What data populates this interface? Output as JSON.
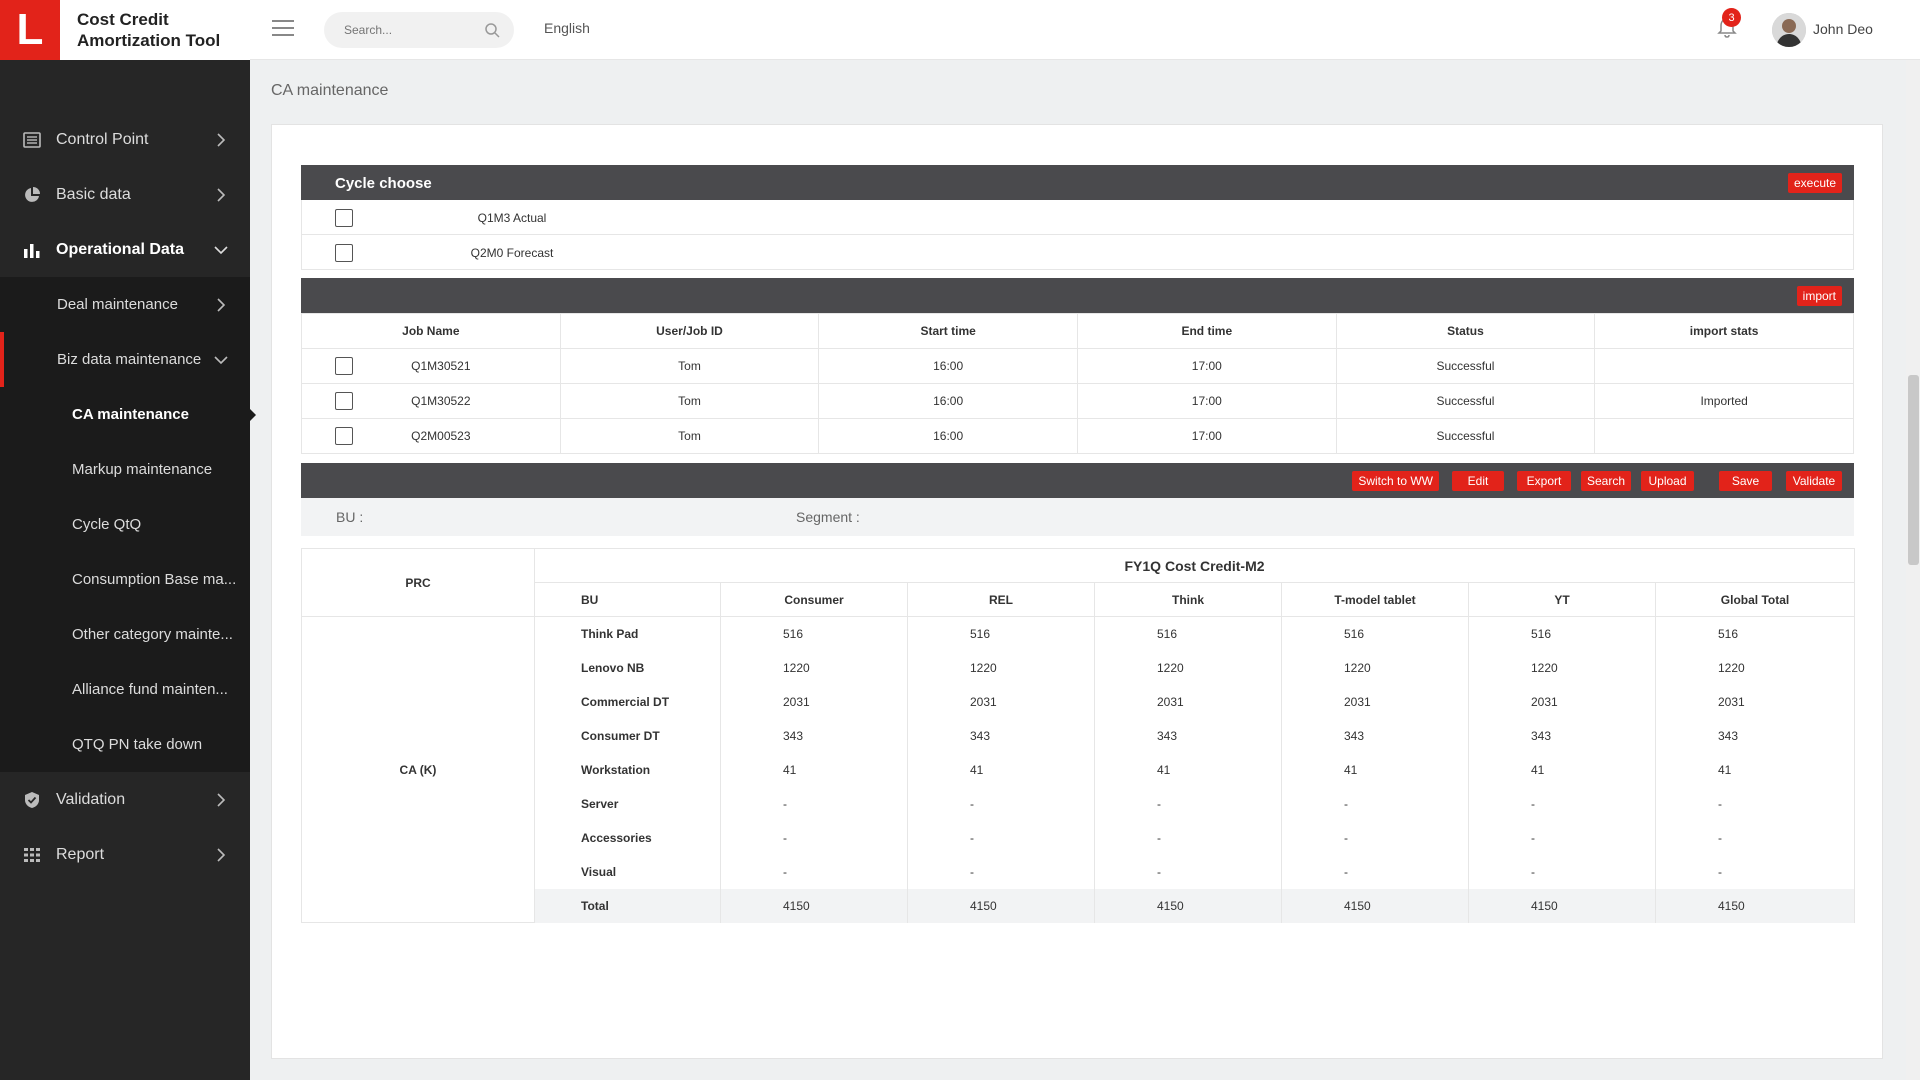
{
  "app": {
    "title": "Cost Credit Amortization Tool",
    "logo_letter": "L"
  },
  "topbar": {
    "search_placeholder": "Search...",
    "language": "English",
    "notifications": "3",
    "user": "John Deo"
  },
  "sidebar": {
    "items": [
      {
        "label": "Control Point"
      },
      {
        "label": "Basic data"
      },
      {
        "label": "Operational Data"
      },
      {
        "label": "Deal maintenance"
      },
      {
        "label": "Biz data maintenance"
      },
      {
        "label": "CA maintenance"
      },
      {
        "label": "Markup maintenance"
      },
      {
        "label": "Cycle QtQ"
      },
      {
        "label": "Consumption Base ma..."
      },
      {
        "label": "Other category mainte..."
      },
      {
        "label": "Alliance fund mainten..."
      },
      {
        "label": "QTQ PN take down"
      },
      {
        "label": "Validation"
      },
      {
        "label": "Report"
      }
    ]
  },
  "page": {
    "title": "CA maintenance"
  },
  "cycle": {
    "title": "Cycle choose",
    "execute": "execute",
    "options": [
      "Q1M3 Actual",
      "Q2M0 Forecast"
    ]
  },
  "jobs": {
    "import": "import",
    "headers": [
      "Job Name",
      "User/Job ID",
      "Start time",
      "End time",
      "Status",
      "import stats"
    ],
    "rows": [
      [
        "Q1M30521",
        "Tom",
        "16:00",
        "17:00",
        "Successful",
        ""
      ],
      [
        "Q1M30522",
        "Tom",
        "16:00",
        "17:00",
        "Successful",
        "Imported"
      ],
      [
        "Q2M00523",
        "Tom",
        "16:00",
        "17:00",
        "Successful",
        ""
      ]
    ]
  },
  "toolbar": {
    "buttons": [
      "Switch to WW",
      "Edit",
      "Export",
      "Search",
      "Upload",
      "Save",
      "Validate"
    ]
  },
  "filter": {
    "bu_label": "BU :",
    "segment_label": "Segment :"
  },
  "table": {
    "group_title": "FY1Q Cost Credit-M2",
    "prc_header": "PRC",
    "prc_value": "CA (K)",
    "columns": [
      "BU",
      "Consumer",
      "REL",
      "Think",
      "T-model tablet",
      "YT",
      "Global Total"
    ],
    "rows": [
      [
        "Think Pad",
        "516",
        "516",
        "516",
        "516",
        "516",
        "516"
      ],
      [
        "Lenovo NB",
        "1220",
        "1220",
        "1220",
        "1220",
        "1220",
        "1220"
      ],
      [
        "Commercial DT",
        "2031",
        "2031",
        "2031",
        "2031",
        "2031",
        "2031"
      ],
      [
        "Consumer DT",
        "343",
        "343",
        "343",
        "343",
        "343",
        "343"
      ],
      [
        "Workstation",
        "41",
        "41",
        "41",
        "41",
        "41",
        "41"
      ],
      [
        "Server",
        "-",
        "-",
        "-",
        "-",
        "-",
        "-"
      ],
      [
        "Accessories",
        "-",
        "-",
        "-",
        "-",
        "-",
        "-"
      ],
      [
        "Visual",
        "-",
        "-",
        "-",
        "-",
        "-",
        "-"
      ],
      [
        "Total",
        "4150",
        "4150",
        "4150",
        "4150",
        "4150",
        "4150"
      ]
    ]
  },
  "colors": {
    "accent": "#e2231a",
    "sidebar": "#262626",
    "bar": "#4a4a4d"
  }
}
